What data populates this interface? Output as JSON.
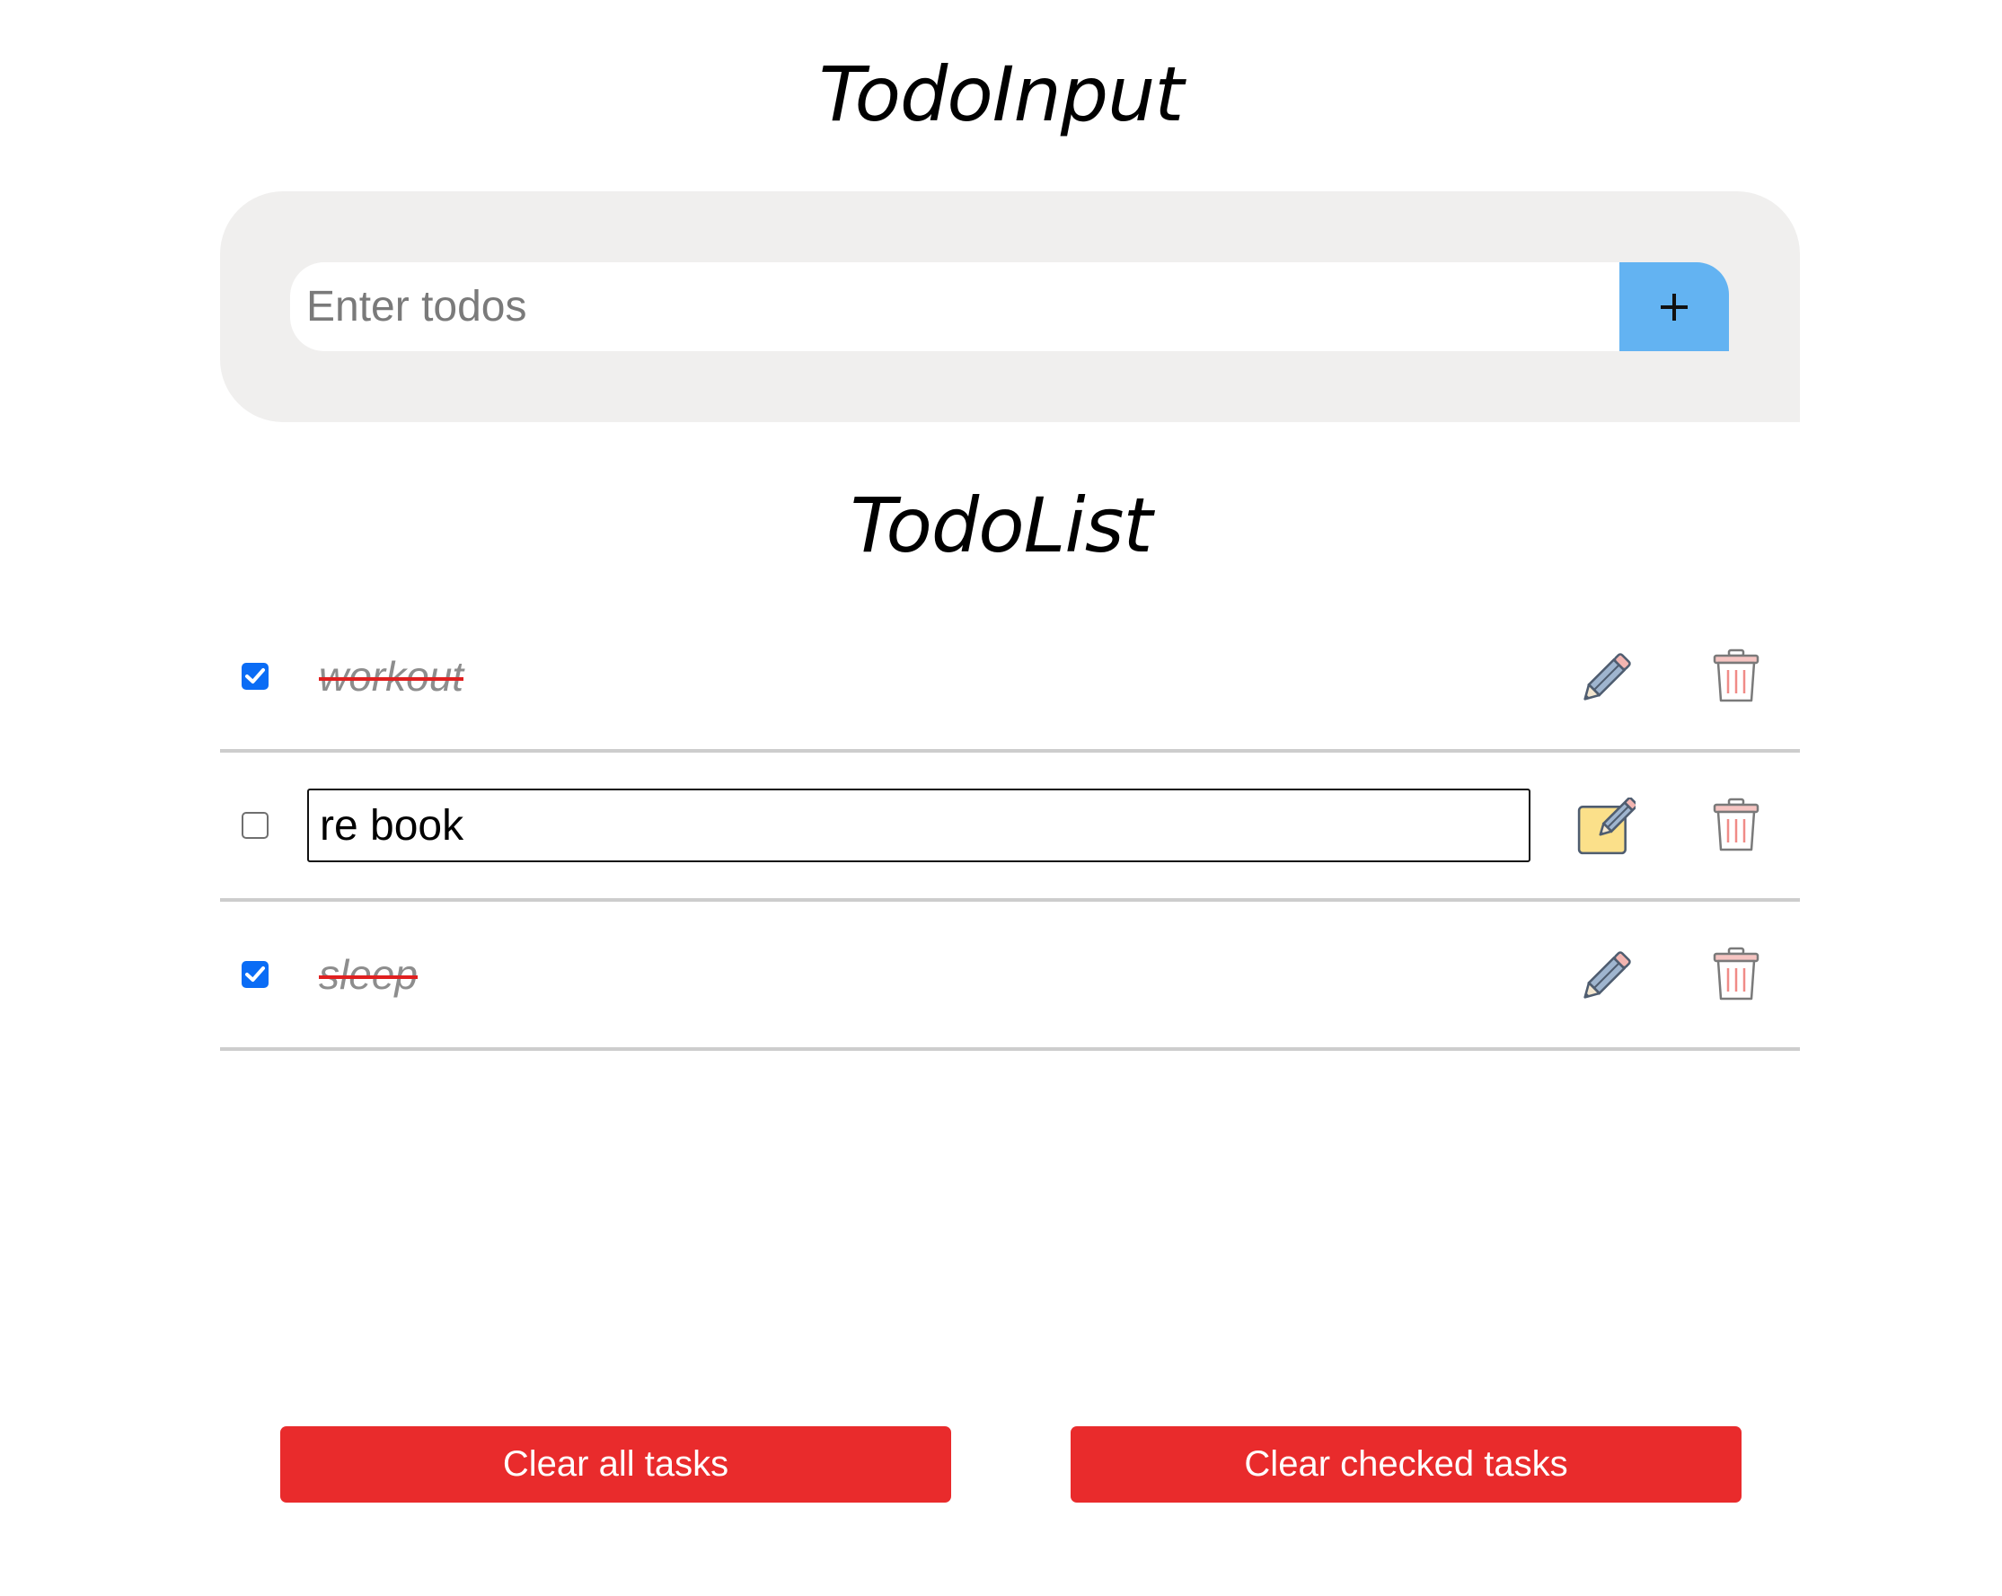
{
  "input_section": {
    "title": "TodoInput",
    "placeholder": "Enter todos",
    "value": "",
    "add_label": "+"
  },
  "list_section": {
    "title": "TodoList",
    "items": [
      {
        "text": "workout",
        "checked": true,
        "editing": false
      },
      {
        "text": "re book",
        "checked": false,
        "editing": true
      },
      {
        "text": "sleep",
        "checked": true,
        "editing": false
      }
    ]
  },
  "icons": {
    "edit": "pencil-icon",
    "edit_active": "pencil-square-icon",
    "delete": "trash-icon",
    "checkbox_checked": "checkmark-icon"
  },
  "footer": {
    "clear_all_label": "Clear all tasks",
    "clear_checked_label": "Clear checked tasks"
  },
  "colors": {
    "panel_bg": "#f0efee",
    "add_button": "#63b3f2",
    "checkbox": "#0a6cf5",
    "strike": "#e02020",
    "danger_button": "#e92b2c",
    "divider": "#cdcdcd"
  }
}
